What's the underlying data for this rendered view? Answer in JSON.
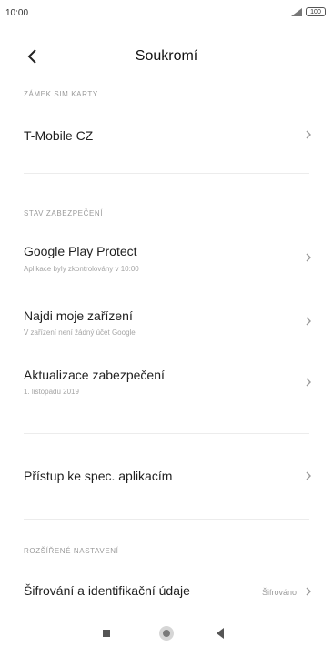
{
  "status_bar": {
    "time": "10:00",
    "signal_icon": "signal-icon",
    "battery_label": "100"
  },
  "header": {
    "title": "Soukromí",
    "back_icon": "chevron-left-icon"
  },
  "sections": {
    "sim_lock": {
      "header": "ZÁMEK SIM KARTY",
      "items": [
        {
          "title": "T-Mobile CZ"
        }
      ]
    },
    "security_status": {
      "header": "STAV ZABEZPEČENÍ",
      "items": [
        {
          "title": "Google Play Protect",
          "subtitle": "Aplikace byly zkontrolovány v 10:00"
        },
        {
          "title": "Najdi moje zařízení",
          "subtitle": "V zařízení není žádný účet Google"
        },
        {
          "title": "Aktualizace zabezpečení",
          "subtitle": "1. listopadu 2019"
        }
      ]
    },
    "special_access": {
      "items": [
        {
          "title": "Přístup ke spec. aplikacím"
        }
      ]
    },
    "advanced": {
      "header": "ROZŠÍŘENÉ NASTAVENÍ",
      "items": [
        {
          "title": "Šifrování a identifikační údaje",
          "value": "Šifrováno"
        }
      ]
    }
  },
  "nav_bar": {
    "recents_icon": "square-icon",
    "home_icon": "circle-icon",
    "back_icon": "triangle-back-icon"
  }
}
